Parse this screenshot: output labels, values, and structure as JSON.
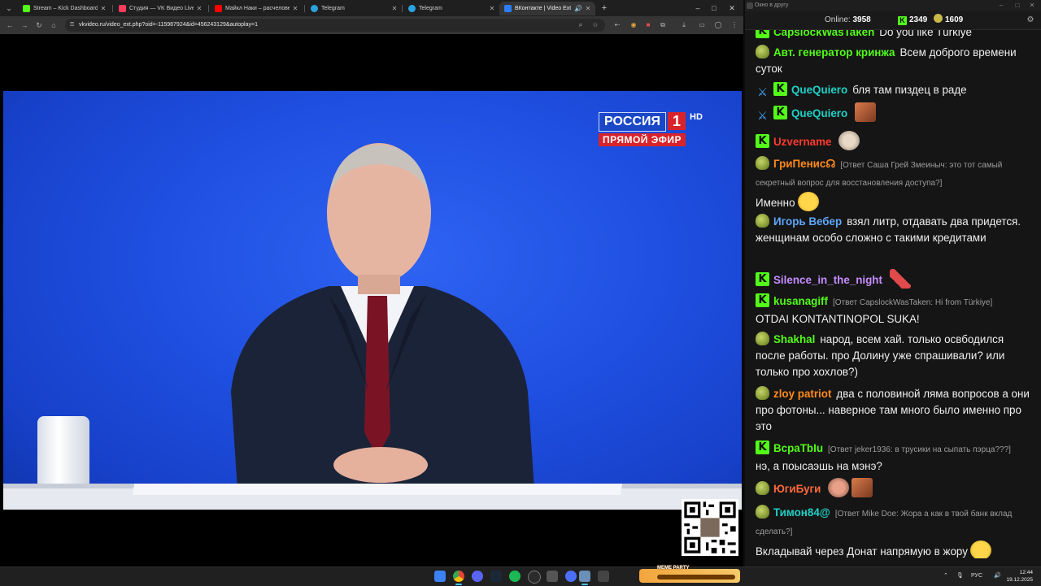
{
  "browser": {
    "tabs": [
      {
        "label": "Stream – Kick Dashboard",
        "color": "#53fc18",
        "active": false
      },
      {
        "label": "Студия — VK Видео Live",
        "color": "#ff3b5c",
        "active": false
      },
      {
        "label": "Майкл Наки – расчеловечива",
        "color": "#ff0000",
        "active": false
      },
      {
        "label": "Telegram",
        "color": "#2aa3e0",
        "active": false
      },
      {
        "label": "Telegram",
        "color": "#2aa3e0",
        "active": false
      },
      {
        "label": "ВКонтакте | Video Ext",
        "color": "#2d7dfa",
        "active": true
      }
    ],
    "url": "vkvideo.ru/video_ext.php?oid=-115987924&id=456243129&autoplay=1",
    "new_tab_symbol": "+",
    "window_controls": {
      "minimize": "–",
      "maximize": "□",
      "close": "✕"
    }
  },
  "video": {
    "channel_name": "РОССИЯ",
    "channel_number": "1",
    "channel_hd": "HD",
    "live_label": "ПРЯМОЙ ЭФИР"
  },
  "chat": {
    "window_title": "Окно в другу",
    "online_label": "Online:",
    "online_count": "3958",
    "kick_count": "2349",
    "other_count": "1609",
    "messages": [
      {
        "badges": [
          "k"
        ],
        "nick": "CapslockWasTaken",
        "nick_color": "#53fc18",
        "reply": "",
        "text": "Do you like Türkiye",
        "emotes": []
      },
      {
        "badges": [
          "pepe"
        ],
        "nick": "Авт. генератор кринжа",
        "nick_color": "#53fc18",
        "reply": "",
        "text": "Всем доброго времени суток",
        "emotes": []
      },
      {
        "badges": [
          "sword",
          "k"
        ],
        "nick": "QueQuiero",
        "nick_color": "#1fd1c6",
        "reply": "",
        "text": "бля там пиздец в раде",
        "emotes": []
      },
      {
        "badges": [
          "sword",
          "k"
        ],
        "nick": "QueQuiero",
        "nick_color": "#1fd1c6",
        "reply": "",
        "text": "",
        "emotes": [
          "face1"
        ]
      },
      {
        "badges": [
          "k"
        ],
        "nick": "Uzvername",
        "nick_color": "#ff3b30",
        "reply": "",
        "text": "",
        "emotes": [
          "cat"
        ]
      },
      {
        "badges": [
          "pepe"
        ],
        "nick": "ГриПенис☊",
        "nick_color": "#ff8a1c",
        "reply": "[Ответ Саша Грей Змеиныч: это тот самый секретный вопрос для восстановления доступа?]",
        "text": "Именно",
        "emotes": [
          "laugh"
        ]
      },
      {
        "badges": [
          "pepe"
        ],
        "nick": "Игорь Вебер",
        "nick_color": "#5fa8ff",
        "reply": "",
        "text": "взял литр, отдавать два придется. женщинам особо сложно с такими кредитами",
        "emotes": []
      },
      {
        "badges": [
          "k"
        ],
        "nick": "Silence_in_the_night",
        "nick_color": "#c58cff",
        "reply": "",
        "text": "",
        "emotes": [
          "feather"
        ]
      },
      {
        "badges": [
          "k"
        ],
        "nick": "kusanagiff",
        "nick_color": "#53fc18",
        "reply": "[Ответ CapslockWasTaken: Hi from Türkiye]",
        "text": "OTDAI KONTANTINOPOL SUKA!",
        "emotes": []
      },
      {
        "badges": [
          "pepe"
        ],
        "nick": "Shakhal",
        "nick_color": "#53fc18",
        "reply": "",
        "text": "народ, всем хай. только освбодился после работы. про Долину уже спрашивали? или только про хохлов?)",
        "emotes": []
      },
      {
        "badges": [
          "pepe"
        ],
        "nick": "zloy patriot",
        "nick_color": "#ff8a1c",
        "reply": "",
        "text": "два с половиной ляма вопросов а они про фотоны... наверное там много было именно про это",
        "emotes": []
      },
      {
        "badges": [
          "k"
        ],
        "nick": "ВсраТbIu",
        "nick_color": "#53fc18",
        "reply": "[Ответ jeker1936: в трусики на сыпать пэрца???]",
        "text": "нэ, а поысаэшь на мэнэ?",
        "emotes": []
      },
      {
        "badges": [
          "pepe"
        ],
        "nick": "ЮгиБуги",
        "nick_color": "#ff6a3c",
        "reply": "",
        "text": "",
        "emotes": [
          "face2",
          "face1"
        ]
      },
      {
        "badges": [
          "pepe"
        ],
        "nick": "Тимон84@",
        "nick_color": "#1fd1c6",
        "reply": "[Ответ Mike Doe: Жора а как в твой банк вклад сделать?]",
        "text": "Вкладывай через Донат напрямую в жору",
        "emotes": [
          "laugh"
        ]
      }
    ]
  },
  "taskbar": {
    "meme_widget_label": "MEME PARTY",
    "language": "РУС",
    "time": "12:44",
    "date": "19.12.2025"
  }
}
